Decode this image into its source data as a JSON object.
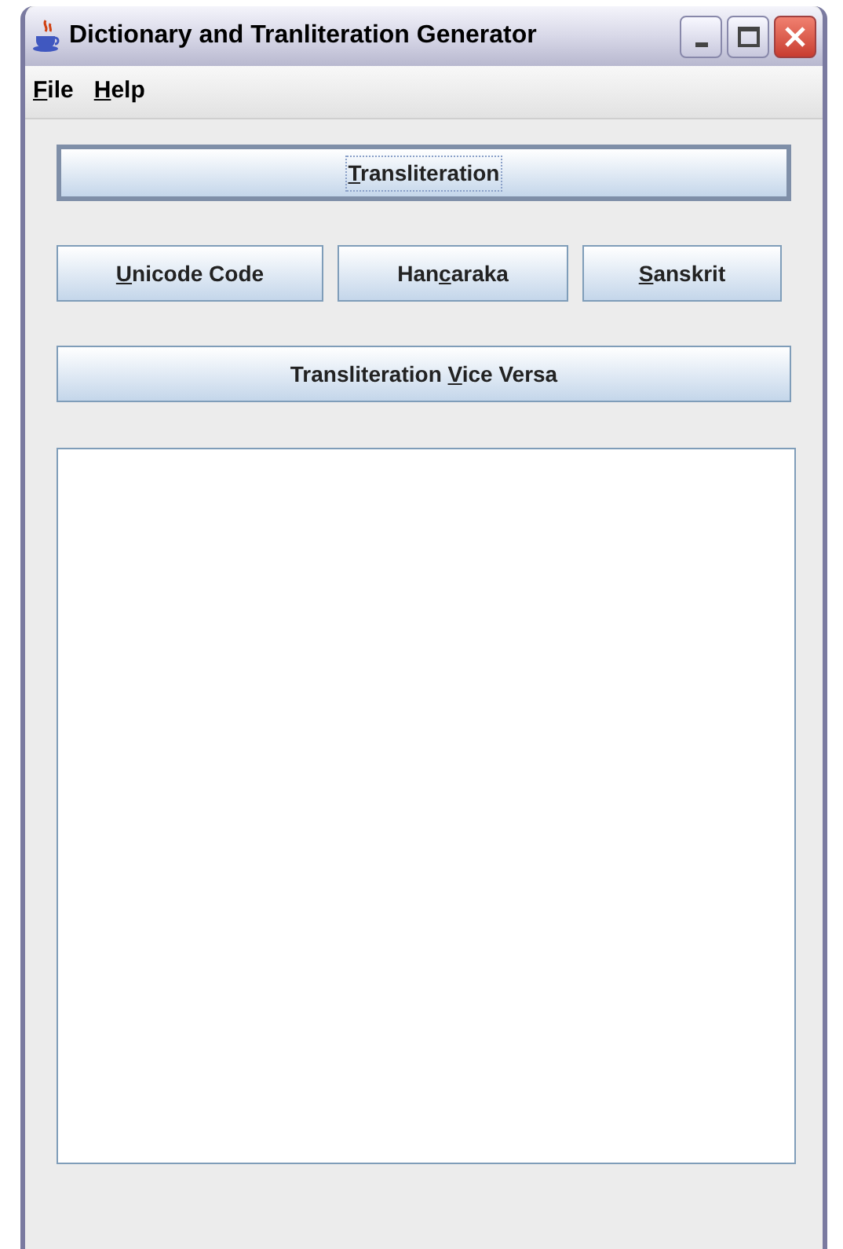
{
  "window": {
    "title": "Dictionary and Tranliteration Generator"
  },
  "menu": [
    {
      "mnemonic": "F",
      "after": "ile"
    },
    {
      "mnemonic": "H",
      "after": "elp"
    }
  ],
  "button_rows": [
    [
      {
        "mnemonic": "T",
        "after": "ransliteration",
        "focused": true
      }
    ],
    [
      {
        "mnemonic": "U",
        "after": "nicode Code",
        "focused": false
      },
      {
        "before": "Han",
        "mnemonic": "c",
        "after": "araka",
        "focused": false
      },
      {
        "mnemonic": "S",
        "after": "anskrit",
        "focused": false
      }
    ],
    [
      {
        "before": "Transliteration ",
        "mnemonic": "V",
        "after": "ice Versa",
        "focused": false
      }
    ]
  ]
}
